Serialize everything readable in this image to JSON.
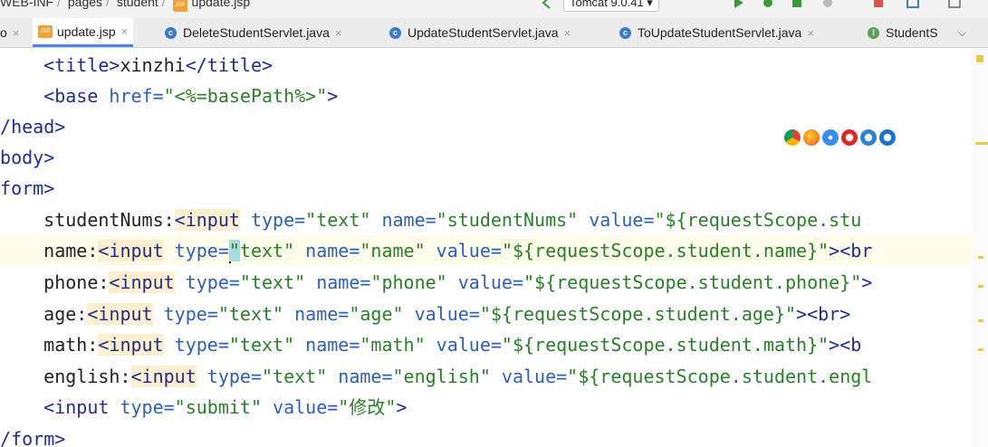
{
  "breadcrumbs": [
    "WEB-INF",
    "pages",
    "student",
    "update.jsp"
  ],
  "run_config": "Tomcat 9.0.41",
  "tabs": [
    {
      "label": "o",
      "icon": "none"
    },
    {
      "label": "update.jsp",
      "icon": "jsp-file-icon"
    },
    {
      "label": "DeleteStudentServlet.java",
      "icon": "class-icon"
    },
    {
      "label": "UpdateStudentServlet.java",
      "icon": "class-icon"
    },
    {
      "label": "ToUpdateStudentServlet.java",
      "icon": "class-icon"
    },
    {
      "label": "StudentS",
      "icon": "interface-icon"
    }
  ],
  "code": {
    "l1": {
      "indent": "    ",
      "open": "<title>",
      "text": "xinzhi",
      "close": "</title>"
    },
    "l2": {
      "indent": "    ",
      "tag": "<base ",
      "attr": "href=",
      "val": "\"<%=basePath%>\"",
      "end": ">"
    },
    "l3": "</head>",
    "l4": "<body>",
    "l5": "<form>",
    "l6": {
      "label": "    studentNums:",
      "tag": "<input",
      "a1": " type=",
      "v1": "\"text\"",
      "a2": " name=",
      "v2": "\"studentNums\"",
      "a3": " value=",
      "v3": "\"${requestScope.stu"
    },
    "l7": {
      "label": "    name:",
      "tag": "<input",
      "a1": " type=",
      "v1a": "\"",
      "v1b": "text\"",
      "a2": " name=",
      "v2": "\"name\"",
      "a3": " value=",
      "v3": "\"${requestScope.student.name}\"",
      "end": "><br"
    },
    "l8": {
      "label": "    phone:",
      "tag": "<input",
      "a1": " type=",
      "v1": "\"text\"",
      "a2": " name=",
      "v2": "\"phone\"",
      "a3": " value=",
      "v3": "\"${requestScope.student.phone}\"",
      "end": ">"
    },
    "l9": {
      "label": "    age:",
      "tag": "<input",
      "a1": " type=",
      "v1": "\"text\"",
      "a2": " name=",
      "v2": "\"age\"",
      "a3": " value=",
      "v3": "\"${requestScope.student.age}\"",
      "end": "><br>"
    },
    "l10": {
      "label": "    math:",
      "tag": "<input",
      "a1": " type=",
      "v1": "\"text\"",
      "a2": " name=",
      "v2": "\"math\"",
      "a3": " value=",
      "v3": "\"${requestScope.student.math}\"",
      "end": "><b"
    },
    "l11": {
      "label": "    english:",
      "tag": "<input",
      "a1": " type=",
      "v1": "\"text\"",
      "a2": " name=",
      "v2": "\"english\"",
      "a3": " value=",
      "v3": "\"${requestScope.student.engl"
    },
    "l12": {
      "indent": "    ",
      "tag": "<input",
      "a1": " type=",
      "v1": "\"submit\"",
      "a2": " value=",
      "v2": "\"修改\"",
      "end": ">"
    },
    "l13": "</form>"
  },
  "browser_icons": [
    "chrome-icon",
    "firefox-icon",
    "safari-icon",
    "opera-icon",
    "ie-icon",
    "edge-icon"
  ],
  "colors": {
    "tag": "#1f2d8c",
    "attr": "#2d5fb8",
    "string": "#2a7f2a",
    "tab_active_underline": "#4a86e8"
  }
}
